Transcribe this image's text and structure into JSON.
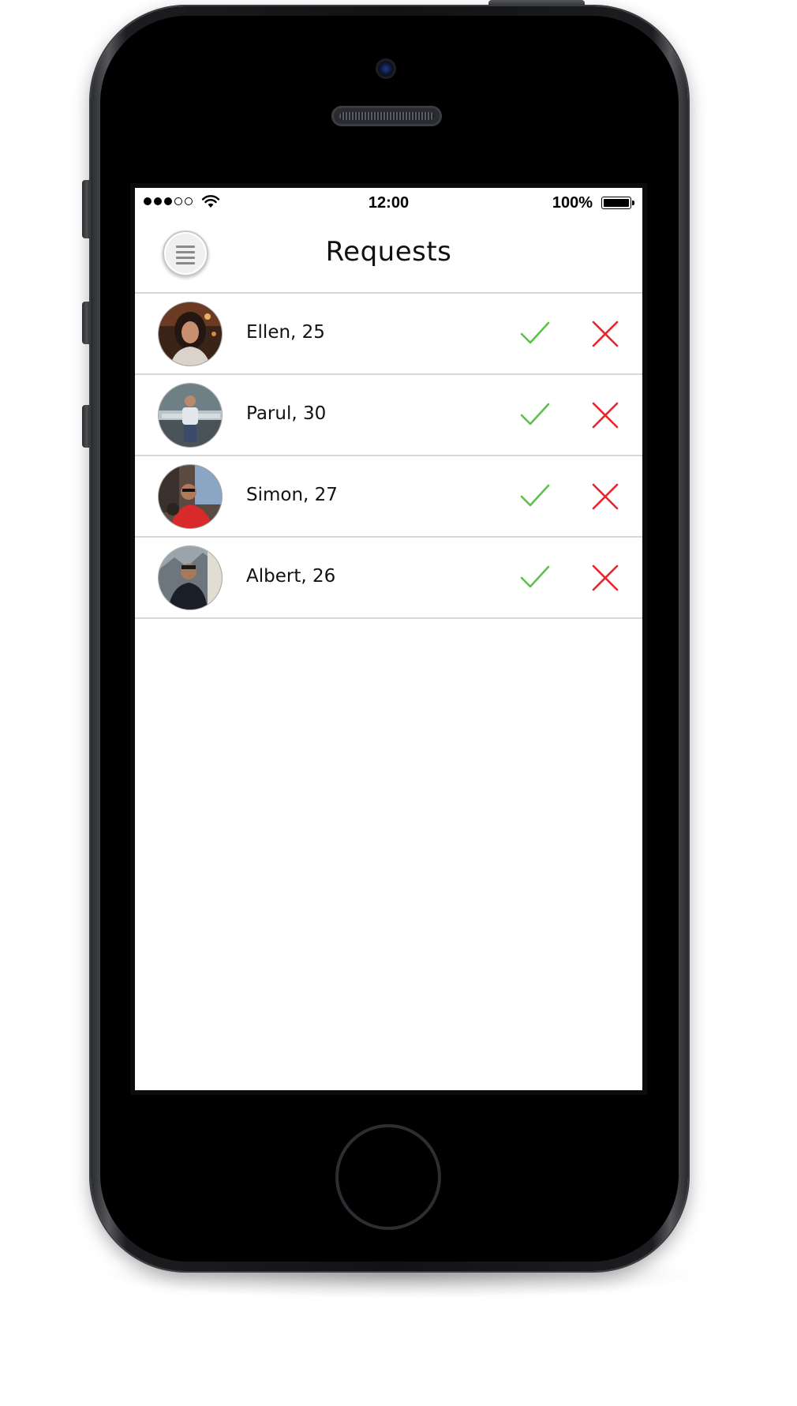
{
  "status_bar": {
    "signal_bars_filled": 3,
    "signal_bars_total": 5,
    "wifi_icon": "wifi-icon",
    "time": "12:00",
    "battery_percent": "100%",
    "battery_level": 1.0
  },
  "nav": {
    "title": "Requests",
    "menu_icon": "hamburger-menu-icon"
  },
  "colors": {
    "accept": "#5cc24a",
    "reject": "#e8262c",
    "divider": "#d8d8d8",
    "text": "#111111"
  },
  "requests": [
    {
      "name_age": "Ellen, 25",
      "avatar": "profile-photo-ellen",
      "accept_icon": "checkmark-icon",
      "reject_icon": "cross-icon"
    },
    {
      "name_age": "Parul, 30",
      "avatar": "profile-photo-parul",
      "accept_icon": "checkmark-icon",
      "reject_icon": "cross-icon"
    },
    {
      "name_age": "Simon, 27",
      "avatar": "profile-photo-simon",
      "accept_icon": "checkmark-icon",
      "reject_icon": "cross-icon"
    },
    {
      "name_age": "Albert, 26",
      "avatar": "profile-photo-albert",
      "accept_icon": "checkmark-icon",
      "reject_icon": "cross-icon"
    }
  ]
}
